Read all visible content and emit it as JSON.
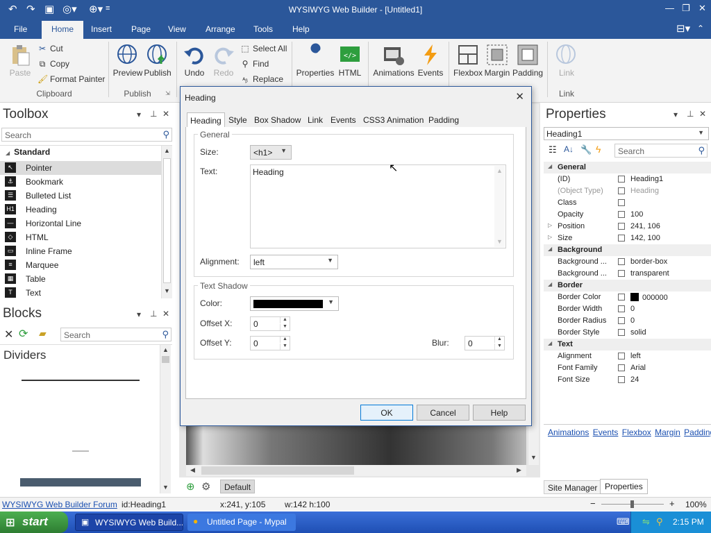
{
  "app": {
    "title": "WYSIWYG Web Builder - [Untitled1]"
  },
  "ribbon_tabs": [
    "File",
    "Home",
    "Insert",
    "Page",
    "View",
    "Arrange",
    "Tools",
    "Help"
  ],
  "ribbon": {
    "paste": "Paste",
    "cut": "Cut",
    "copy": "Copy",
    "format_painter": "Format Painter",
    "clipboard_group": "Clipboard",
    "preview": "Preview",
    "publish": "Publish",
    "publish_group": "Publish",
    "undo": "Undo",
    "redo": "Redo",
    "select_all": "Select All",
    "find": "Find",
    "replace": "Replace",
    "properties": "Properties",
    "html": "HTML",
    "animations": "Animations",
    "events": "Events",
    "flexbox": "Flexbox",
    "margin": "Margin",
    "padding": "Padding",
    "link": "Link",
    "link_group": "Link"
  },
  "toolbox": {
    "title": "Toolbox",
    "search_placeholder": "Search",
    "category": "Standard",
    "items": [
      "Pointer",
      "Bookmark",
      "Bulleted List",
      "Heading",
      "Horizontal Line",
      "HTML",
      "Inline Frame",
      "Marquee",
      "Table",
      "Text"
    ],
    "icons": [
      "arrow-icon",
      "bookmark-icon",
      "list-icon",
      "heading-icon",
      "line-icon",
      "html-icon",
      "iframe-icon",
      "marquee-icon",
      "table-icon",
      "text-icon"
    ]
  },
  "blocks": {
    "title": "Blocks",
    "search_placeholder": "Search",
    "section": "Dividers"
  },
  "dialog": {
    "title": "Heading",
    "tabs": [
      "Heading",
      "Style",
      "Box Shadow",
      "Link",
      "Events",
      "CSS3 Animation",
      "Padding"
    ],
    "general_label": "General",
    "size_label": "Size:",
    "size_value": "<h1>",
    "text_label": "Text:",
    "text_value": "Heading",
    "alignment_label": "Alignment:",
    "alignment_value": "left",
    "shadow_label": "Text Shadow",
    "color_label": "Color:",
    "offset_x_label": "Offset X:",
    "offset_x_value": "0",
    "offset_y_label": "Offset Y:",
    "offset_y_value": "0",
    "blur_label": "Blur:",
    "blur_value": "0",
    "ok": "OK",
    "cancel": "Cancel",
    "help": "Help"
  },
  "properties": {
    "title": "Properties",
    "object": "Heading1",
    "search_placeholder": "Search",
    "rows": [
      {
        "name": "General",
        "cat": true
      },
      {
        "name": "(ID)",
        "value": "Heading1"
      },
      {
        "name": "(Object Type)",
        "value": "Heading",
        "muted": true
      },
      {
        "name": "Class",
        "value": ""
      },
      {
        "name": "Opacity",
        "value": "100"
      },
      {
        "name": "Position",
        "value": "241, 106",
        "exp": true
      },
      {
        "name": "Size",
        "value": "142, 100",
        "exp": true
      },
      {
        "name": "Background",
        "cat": true
      },
      {
        "name": "Background ...",
        "value": "border-box"
      },
      {
        "name": "Background ...",
        "value": "transparent"
      },
      {
        "name": "Border",
        "cat": true
      },
      {
        "name": "Border Color",
        "value": "000000",
        "swatch": "#000000"
      },
      {
        "name": "Border Width",
        "value": "0"
      },
      {
        "name": "Border Radius",
        "value": "0"
      },
      {
        "name": "Border Style",
        "value": "solid"
      },
      {
        "name": "Text",
        "cat": true
      },
      {
        "name": "Alignment",
        "value": "left"
      },
      {
        "name": "Font Family",
        "value": "Arial"
      },
      {
        "name": "Font Size",
        "value": "24"
      }
    ],
    "links": [
      "Animations",
      "Events",
      "Flexbox",
      "Margin",
      "Padding"
    ],
    "bottom_tabs": [
      "Site Manager",
      "Properties"
    ]
  },
  "canvas": {
    "page_tab": "Default"
  },
  "status": {
    "forum": "WYSIWYG Web Builder Forum",
    "id": "id:Heading1",
    "pos": "x:241, y:105",
    "size": "w:142 h:100",
    "zoom": "100%"
  },
  "taskbar": {
    "start": "start",
    "items": [
      "WYSIWYG Web Build...",
      "Untitled Page - Mypal"
    ],
    "time": "2:15 PM"
  },
  "colors": {
    "accent": "#2b579a",
    "shadow_color": "#000000"
  }
}
